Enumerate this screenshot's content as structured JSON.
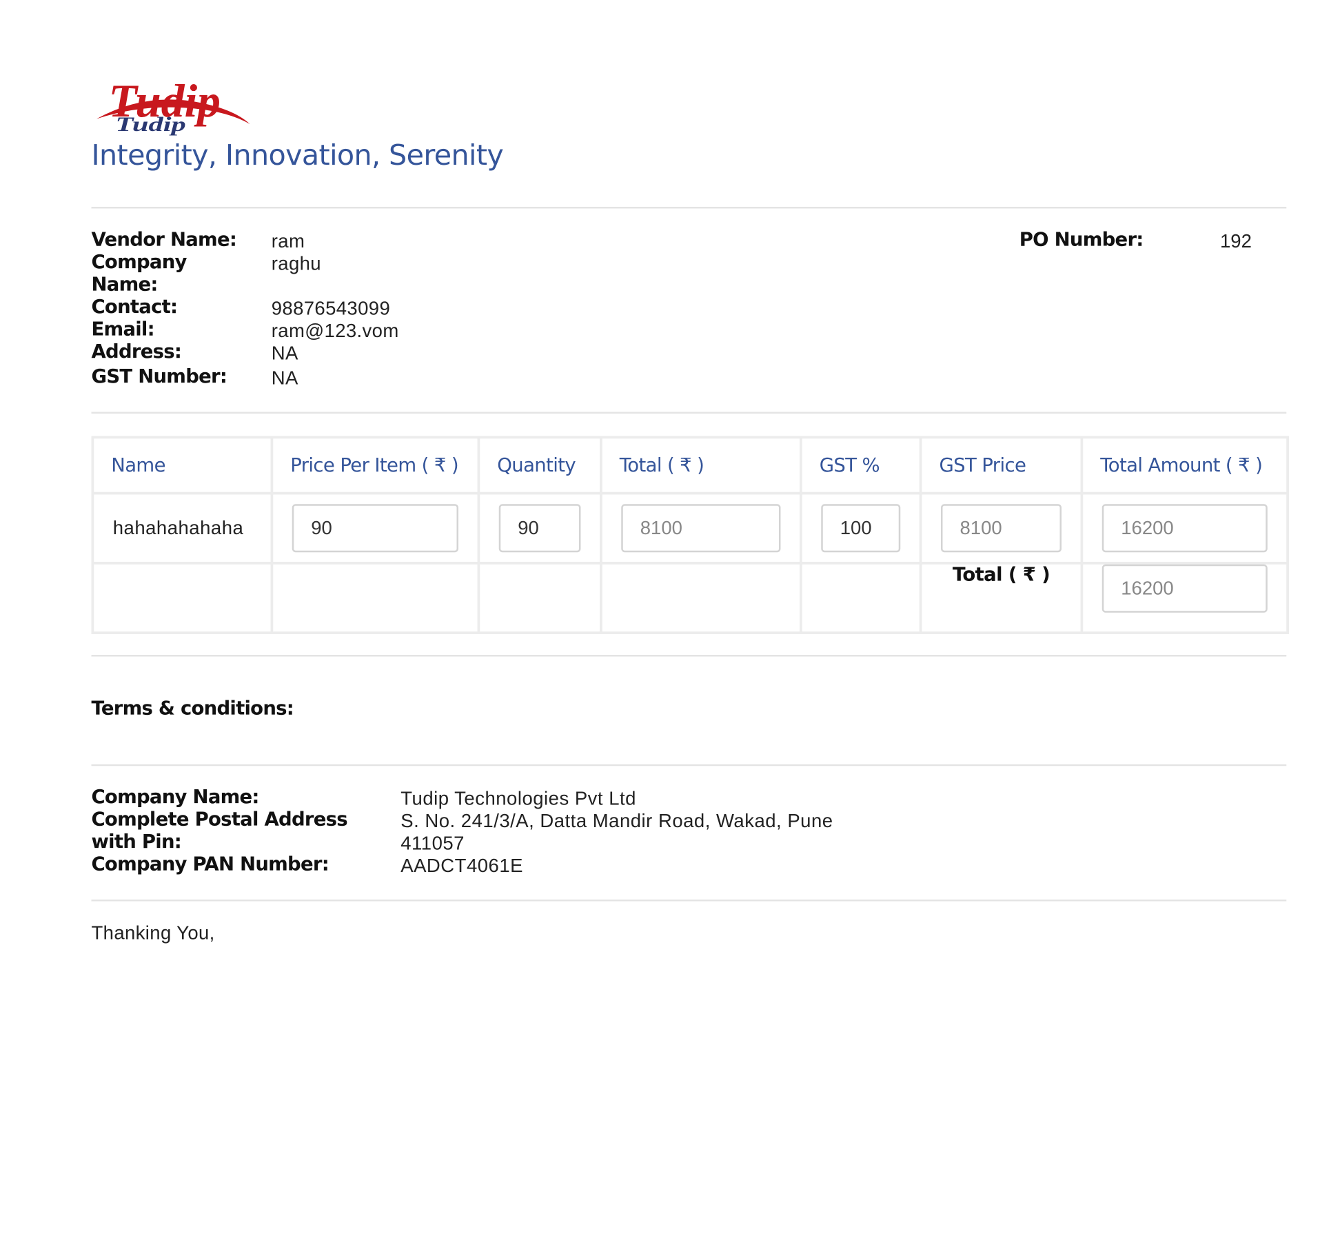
{
  "header": {
    "logo_text": "Tudip",
    "tagline": "Integrity, Innovation, Serenity"
  },
  "vendor": {
    "name_label": "Vendor Name:",
    "name_value": "ram",
    "company_label": "Company Name:",
    "company_value": "raghu",
    "contact_label": "Contact:",
    "contact_value": "98876543099",
    "email_label": "Email:",
    "email_value": "ram@123.vom",
    "address_label": "Address:",
    "address_value": "NA",
    "gst_label": "GST Number:",
    "gst_value": "NA"
  },
  "po": {
    "label": "PO Number:",
    "value": "192"
  },
  "table": {
    "headers": [
      "Name",
      "Price Per Item ( ₹ )",
      "Quantity",
      "Total ( ₹ )",
      "GST %",
      "GST Price",
      "Total Amount ( ₹ )"
    ],
    "row": {
      "name": "hahahahahaha",
      "price": "90",
      "quantity": "90",
      "total": "8100",
      "gst_percent": "100",
      "gst_price": "8100",
      "total_amount": "16200"
    },
    "footer": {
      "total_label": "Total ( ₹ )",
      "grand_total": "16200"
    }
  },
  "terms": {
    "label": "Terms & conditions:"
  },
  "company": {
    "name_label": "Company Name:",
    "name_value": "Tudip Technologies Pvt Ltd",
    "address_label": "Complete Postal Address with Pin:",
    "address_value": "S. No. 241/3/A, Datta Mandir Road, Wakad, Pune 411057",
    "pan_label": "Company PAN Number:",
    "pan_value": "AADCT4061E"
  },
  "closing": {
    "text": "Thanking You,"
  },
  "colors": {
    "brand_blue": "#35559a",
    "logo_red": "#c8181e",
    "logo_navy": "#1f2e6b"
  }
}
